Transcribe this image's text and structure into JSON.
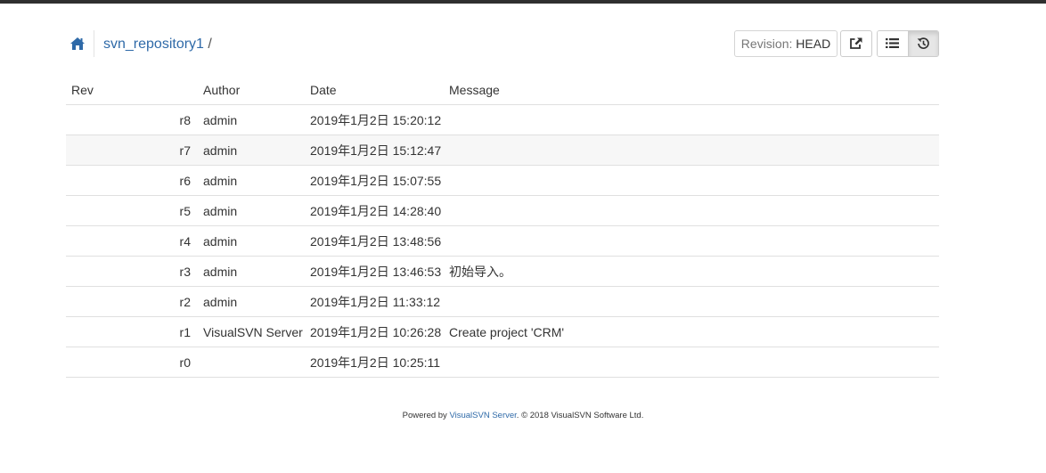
{
  "header": {
    "repo_name": "svn_repository1",
    "path_sep": "/",
    "revision_label": "Revision:",
    "revision_value": "HEAD"
  },
  "table": {
    "columns": [
      "Rev",
      "Author",
      "Date",
      "Message"
    ],
    "rows": [
      {
        "rev": "r8",
        "author": "admin",
        "date": "2019年1月2日 15:20:12",
        "message": ""
      },
      {
        "rev": "r7",
        "author": "admin",
        "date": "2019年1月2日 15:12:47",
        "message": ""
      },
      {
        "rev": "r6",
        "author": "admin",
        "date": "2019年1月2日 15:07:55",
        "message": ""
      },
      {
        "rev": "r5",
        "author": "admin",
        "date": "2019年1月2日 14:28:40",
        "message": ""
      },
      {
        "rev": "r4",
        "author": "admin",
        "date": "2019年1月2日 13:48:56",
        "message": ""
      },
      {
        "rev": "r3",
        "author": "admin",
        "date": "2019年1月2日 13:46:53",
        "message": "初始导入。"
      },
      {
        "rev": "r2",
        "author": "admin",
        "date": "2019年1月2日 11:33:12",
        "message": ""
      },
      {
        "rev": "r1",
        "author": "VisualSVN Server",
        "date": "2019年1月2日 10:26:28",
        "message": "Create project 'CRM'"
      },
      {
        "rev": "r0",
        "author": "",
        "date": "2019年1月2日 10:25:11",
        "message": ""
      }
    ]
  },
  "footer": {
    "prefix": "Powered by ",
    "link": "VisualSVN Server",
    "suffix": ". © 2018 VisualSVN Software Ltd."
  },
  "colors": {
    "link": "#2f6aa8",
    "top_bar": "#2f2f2f",
    "stripe": "#f7f7f7"
  },
  "icons": [
    "home-icon",
    "external-link-icon",
    "list-icon",
    "history-icon"
  ]
}
